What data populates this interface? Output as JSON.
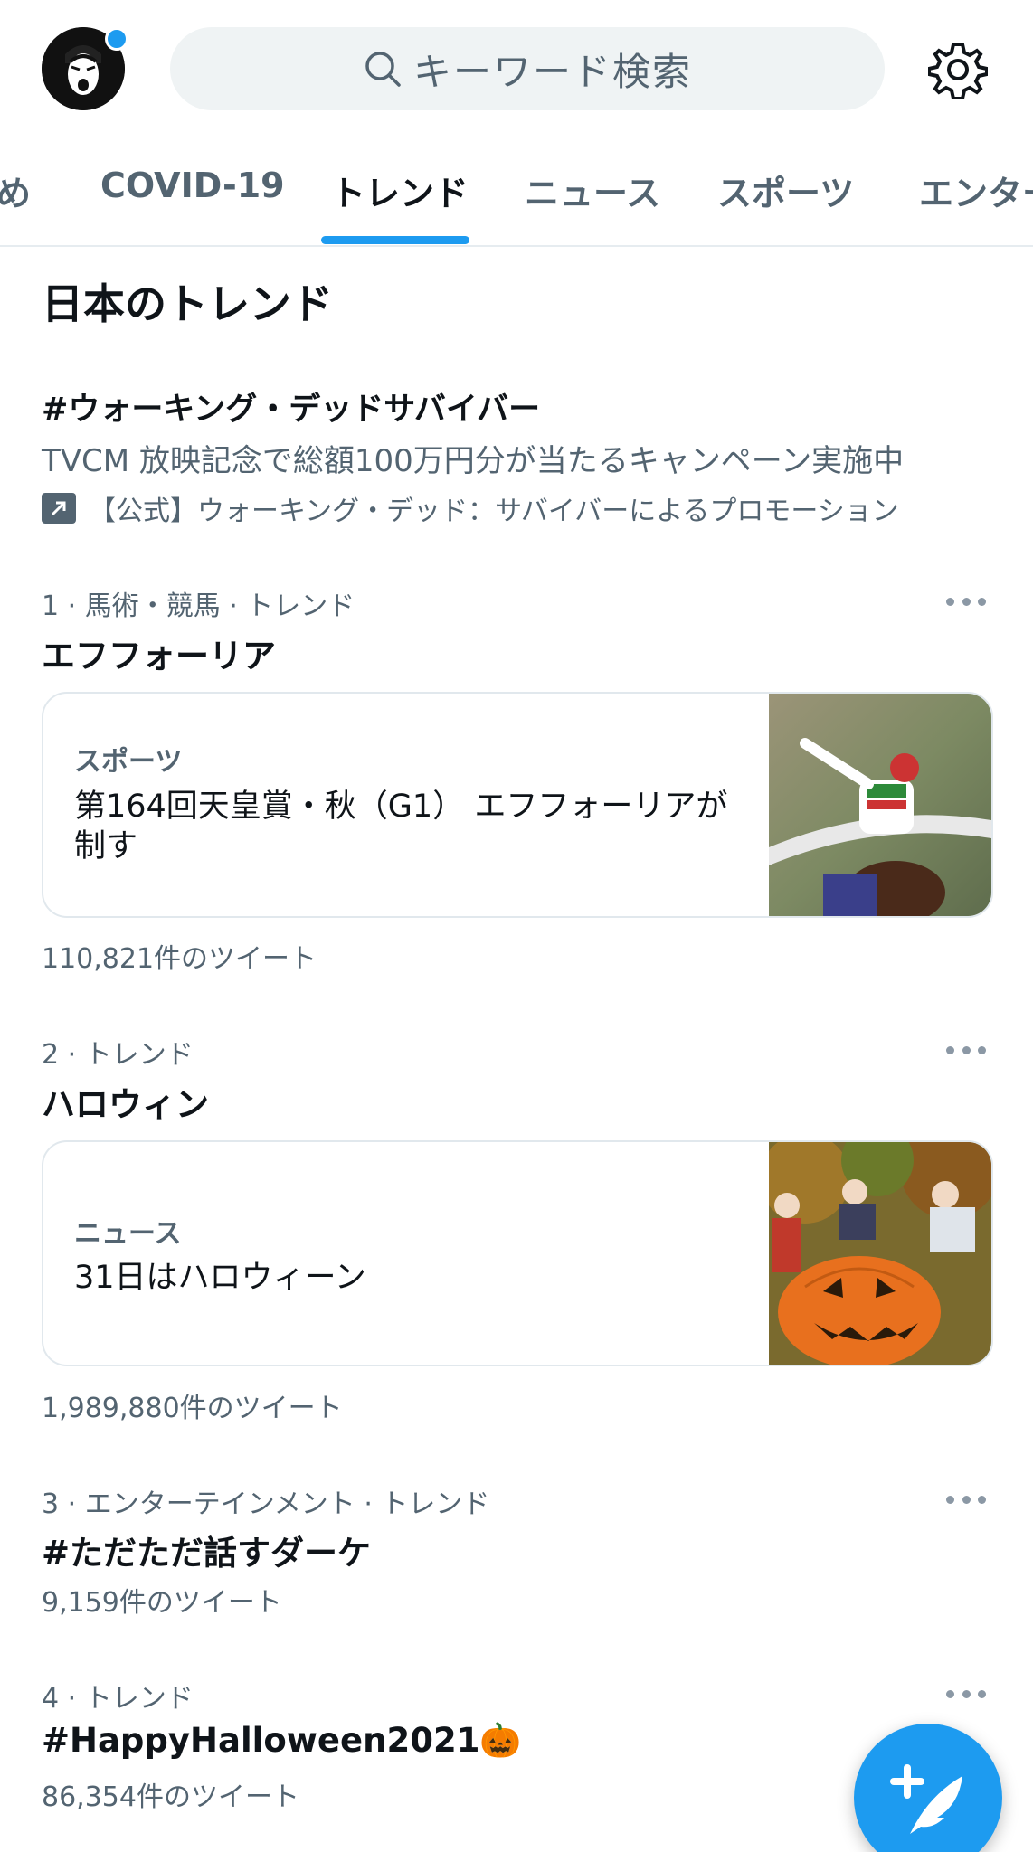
{
  "header": {
    "search_placeholder": "キーワード検索"
  },
  "tabs": [
    {
      "label": "め"
    },
    {
      "label": "COVID-19"
    },
    {
      "label": "トレンド",
      "active": true
    },
    {
      "label": "ニュース"
    },
    {
      "label": "スポーツ"
    },
    {
      "label": "エンター"
    }
  ],
  "section": {
    "title": "日本のトレンド"
  },
  "promo": {
    "title": "#ウォーキング・デッドサバイバー",
    "description": "TVCM 放映記念で総額100万円分が当たるキャンペーン実施中",
    "promoted_by": "【公式】ウォーキング・デッド：サバイバーによるプロモーション",
    "icon": "promoted-arrow-icon"
  },
  "trends": [
    {
      "meta": "1 · 馬術・競馬 · トレンド",
      "name": "エフフォーリア",
      "card": {
        "category": "スポーツ",
        "text": "第164回天皇賞・秋（G1） エフフォーリアが制す",
        "image": "horse-racing-photo"
      },
      "count": "110,821件のツイート"
    },
    {
      "meta": "2 · トレンド",
      "name": "ハロウィン",
      "card": {
        "category": "ニュース",
        "text": "31日はハロウィーン",
        "image": "halloween-pumpkin-photo"
      },
      "count": "1,989,880件のツイート"
    },
    {
      "meta": "3 · エンターテインメント · トレンド",
      "name": "#ただただ話すダーケ",
      "count": "9,159件のツイート"
    },
    {
      "meta": "4 · トレンド",
      "name": "#HappyHalloween2021🎃",
      "count": "86,354件のツイート"
    }
  ],
  "colors": {
    "accent": "#1d9bf0",
    "secondary_text": "#536471",
    "primary_text": "#0f1419"
  }
}
